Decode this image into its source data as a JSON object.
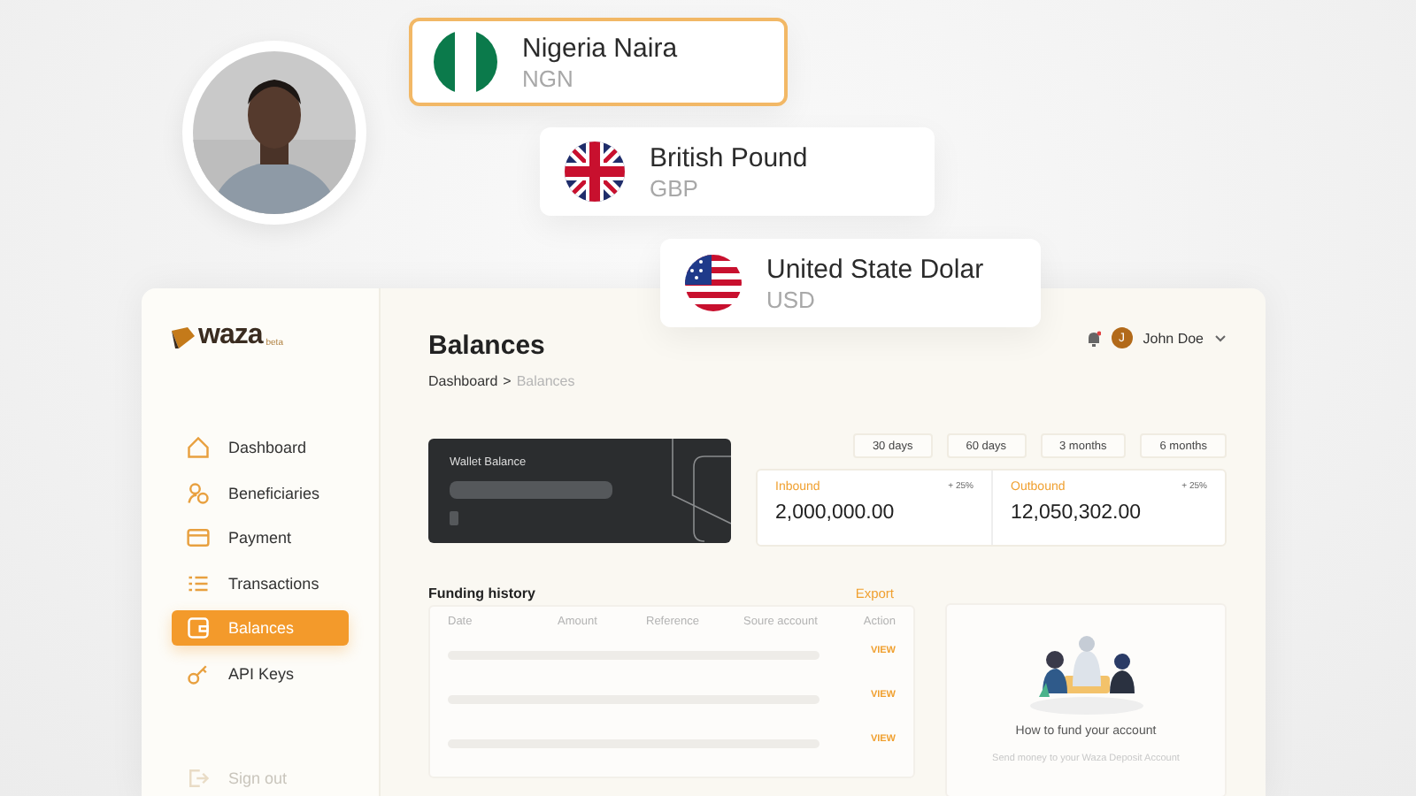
{
  "currencies": [
    {
      "name": "Nigeria Naira",
      "code": "NGN",
      "kind": "nigeria",
      "selected": true
    },
    {
      "name": "British Pound",
      "code": "GBP",
      "kind": "britain",
      "selected": false
    },
    {
      "name": "United State Dolar",
      "code": "USD",
      "kind": "usa",
      "selected": false
    }
  ],
  "sidebar": {
    "logo": "waza",
    "logo_badge": "beta",
    "items": [
      {
        "label": "Dashboard",
        "kind": "home",
        "selected": false
      },
      {
        "label": "Beneficiaries",
        "kind": "users",
        "selected": false
      },
      {
        "label": "Payment",
        "kind": "card",
        "selected": false
      },
      {
        "label": "Transactions",
        "kind": "list",
        "selected": false
      },
      {
        "label": "Balances",
        "kind": "wallet",
        "selected": true
      },
      {
        "label": "API Keys",
        "kind": "key",
        "selected": false
      }
    ],
    "sign_out": {
      "label": "Sign out",
      "disabled": true
    }
  },
  "header": {
    "title": "Balances",
    "breadcrumb": [
      {
        "label": "Dashboard",
        "current": false
      },
      {
        "label": "Balances",
        "current": true
      }
    ],
    "separator": ">",
    "user": {
      "initial": "J",
      "name": "John Doe"
    }
  },
  "wallet": {
    "label": "Wallet Balance"
  },
  "periods": [
    {
      "label": "30 days",
      "selected": false
    },
    {
      "label": "60 days",
      "selected": false
    },
    {
      "label": "3 months",
      "selected": false
    },
    {
      "label": "6 months",
      "selected": false
    }
  ],
  "stats": [
    {
      "label": "Inbound",
      "change": "+ 25%",
      "value": "2,000,000.00"
    },
    {
      "label": "Outbound",
      "change": "+ 25%",
      "value": "12,050,302.00"
    }
  ],
  "funding": {
    "title": "Funding history",
    "export": "Export",
    "columns": [
      "Date",
      "Amount",
      "Reference",
      "Soure account",
      "Action"
    ],
    "rows": [
      {
        "action": "VIEW"
      },
      {
        "action": "VIEW"
      },
      {
        "action": "VIEW"
      }
    ]
  },
  "fund_card": {
    "title": "How to fund your account",
    "text": "Send money to your Waza Deposit Account"
  }
}
